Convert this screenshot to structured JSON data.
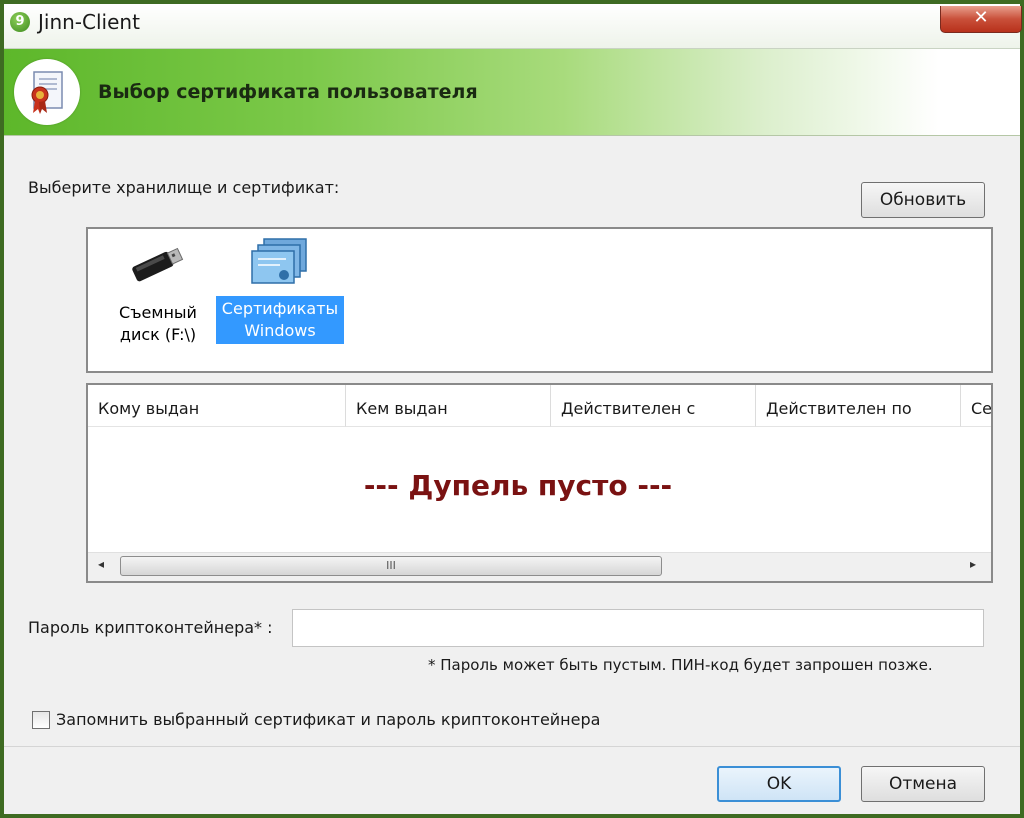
{
  "window": {
    "title": "Jinn-Client",
    "app_icon_glyph": "9",
    "close_glyph": "✕"
  },
  "header": {
    "title": "Выбор сертификата пользователя"
  },
  "store": {
    "prompt": "Выберите хранилище и сертификат:",
    "refresh_label": "Обновить",
    "items": [
      {
        "line1": "Съемный",
        "line2": "диск (F:\\)",
        "icon": "usb-drive-icon",
        "selected": false
      },
      {
        "line1": "Сертификаты",
        "line2": "Windows",
        "icon": "certificates-icon",
        "selected": true
      }
    ]
  },
  "table": {
    "columns": [
      "Кому выдан",
      "Кем выдан",
      "Действителен с",
      "Действителен по",
      "Се"
    ],
    "empty_message": "--- Дупель пусто ---",
    "scroll_thumb_glyph": "III",
    "scroll_left": "◂",
    "scroll_right": "▸"
  },
  "password": {
    "label": "Пароль криптоконтейнера* :",
    "value": "",
    "hint": "* Пароль может быть пустым. ПИН-код будет запрошен позже."
  },
  "remember": {
    "label": "Запомнить выбранный сертификат и пароль криптоконтейнера",
    "checked": false
  },
  "footer": {
    "ok_label": "OK",
    "cancel_label": "Отмена"
  },
  "colors": {
    "frame": "#3e6b22",
    "banner_green": "#5db72a",
    "selection": "#3399ff",
    "empty_text": "#7a1212"
  }
}
